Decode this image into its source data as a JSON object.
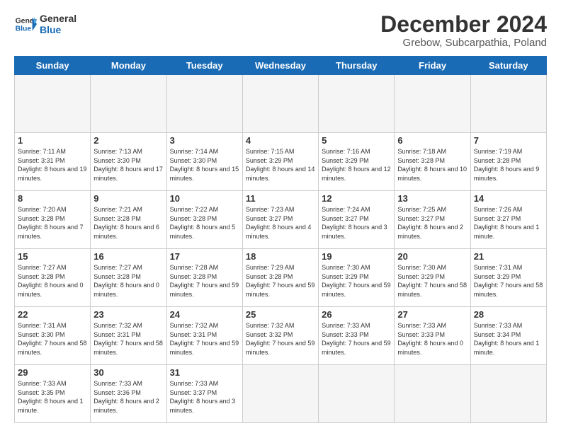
{
  "header": {
    "logo_general": "General",
    "logo_blue": "Blue",
    "month_title": "December 2024",
    "subtitle": "Grebow, Subcarpathia, Poland"
  },
  "days_of_week": [
    "Sunday",
    "Monday",
    "Tuesday",
    "Wednesday",
    "Thursday",
    "Friday",
    "Saturday"
  ],
  "cells": [
    {
      "day": "",
      "empty": true
    },
    {
      "day": "",
      "empty": true
    },
    {
      "day": "",
      "empty": true
    },
    {
      "day": "",
      "empty": true
    },
    {
      "day": "",
      "empty": true
    },
    {
      "day": "",
      "empty": true
    },
    {
      "day": "",
      "empty": true
    },
    {
      "day": "1",
      "sunrise": "Sunrise: 7:11 AM",
      "sunset": "Sunset: 3:31 PM",
      "daylight": "Daylight: 8 hours and 19 minutes."
    },
    {
      "day": "2",
      "sunrise": "Sunrise: 7:13 AM",
      "sunset": "Sunset: 3:30 PM",
      "daylight": "Daylight: 8 hours and 17 minutes."
    },
    {
      "day": "3",
      "sunrise": "Sunrise: 7:14 AM",
      "sunset": "Sunset: 3:30 PM",
      "daylight": "Daylight: 8 hours and 15 minutes."
    },
    {
      "day": "4",
      "sunrise": "Sunrise: 7:15 AM",
      "sunset": "Sunset: 3:29 PM",
      "daylight": "Daylight: 8 hours and 14 minutes."
    },
    {
      "day": "5",
      "sunrise": "Sunrise: 7:16 AM",
      "sunset": "Sunset: 3:29 PM",
      "daylight": "Daylight: 8 hours and 12 minutes."
    },
    {
      "day": "6",
      "sunrise": "Sunrise: 7:18 AM",
      "sunset": "Sunset: 3:28 PM",
      "daylight": "Daylight: 8 hours and 10 minutes."
    },
    {
      "day": "7",
      "sunrise": "Sunrise: 7:19 AM",
      "sunset": "Sunset: 3:28 PM",
      "daylight": "Daylight: 8 hours and 9 minutes."
    },
    {
      "day": "8",
      "sunrise": "Sunrise: 7:20 AM",
      "sunset": "Sunset: 3:28 PM",
      "daylight": "Daylight: 8 hours and 7 minutes."
    },
    {
      "day": "9",
      "sunrise": "Sunrise: 7:21 AM",
      "sunset": "Sunset: 3:28 PM",
      "daylight": "Daylight: 8 hours and 6 minutes."
    },
    {
      "day": "10",
      "sunrise": "Sunrise: 7:22 AM",
      "sunset": "Sunset: 3:28 PM",
      "daylight": "Daylight: 8 hours and 5 minutes."
    },
    {
      "day": "11",
      "sunrise": "Sunrise: 7:23 AM",
      "sunset": "Sunset: 3:27 PM",
      "daylight": "Daylight: 8 hours and 4 minutes."
    },
    {
      "day": "12",
      "sunrise": "Sunrise: 7:24 AM",
      "sunset": "Sunset: 3:27 PM",
      "daylight": "Daylight: 8 hours and 3 minutes."
    },
    {
      "day": "13",
      "sunrise": "Sunrise: 7:25 AM",
      "sunset": "Sunset: 3:27 PM",
      "daylight": "Daylight: 8 hours and 2 minutes."
    },
    {
      "day": "14",
      "sunrise": "Sunrise: 7:26 AM",
      "sunset": "Sunset: 3:27 PM",
      "daylight": "Daylight: 8 hours and 1 minute."
    },
    {
      "day": "15",
      "sunrise": "Sunrise: 7:27 AM",
      "sunset": "Sunset: 3:28 PM",
      "daylight": "Daylight: 8 hours and 0 minutes."
    },
    {
      "day": "16",
      "sunrise": "Sunrise: 7:27 AM",
      "sunset": "Sunset: 3:28 PM",
      "daylight": "Daylight: 8 hours and 0 minutes."
    },
    {
      "day": "17",
      "sunrise": "Sunrise: 7:28 AM",
      "sunset": "Sunset: 3:28 PM",
      "daylight": "Daylight: 7 hours and 59 minutes."
    },
    {
      "day": "18",
      "sunrise": "Sunrise: 7:29 AM",
      "sunset": "Sunset: 3:28 PM",
      "daylight": "Daylight: 7 hours and 59 minutes."
    },
    {
      "day": "19",
      "sunrise": "Sunrise: 7:30 AM",
      "sunset": "Sunset: 3:29 PM",
      "daylight": "Daylight: 7 hours and 59 minutes."
    },
    {
      "day": "20",
      "sunrise": "Sunrise: 7:30 AM",
      "sunset": "Sunset: 3:29 PM",
      "daylight": "Daylight: 7 hours and 58 minutes."
    },
    {
      "day": "21",
      "sunrise": "Sunrise: 7:31 AM",
      "sunset": "Sunset: 3:29 PM",
      "daylight": "Daylight: 7 hours and 58 minutes."
    },
    {
      "day": "22",
      "sunrise": "Sunrise: 7:31 AM",
      "sunset": "Sunset: 3:30 PM",
      "daylight": "Daylight: 7 hours and 58 minutes."
    },
    {
      "day": "23",
      "sunrise": "Sunrise: 7:32 AM",
      "sunset": "Sunset: 3:31 PM",
      "daylight": "Daylight: 7 hours and 58 minutes."
    },
    {
      "day": "24",
      "sunrise": "Sunrise: 7:32 AM",
      "sunset": "Sunset: 3:31 PM",
      "daylight": "Daylight: 7 hours and 59 minutes."
    },
    {
      "day": "25",
      "sunrise": "Sunrise: 7:32 AM",
      "sunset": "Sunset: 3:32 PM",
      "daylight": "Daylight: 7 hours and 59 minutes."
    },
    {
      "day": "26",
      "sunrise": "Sunrise: 7:33 AM",
      "sunset": "Sunset: 3:33 PM",
      "daylight": "Daylight: 7 hours and 59 minutes."
    },
    {
      "day": "27",
      "sunrise": "Sunrise: 7:33 AM",
      "sunset": "Sunset: 3:33 PM",
      "daylight": "Daylight: 8 hours and 0 minutes."
    },
    {
      "day": "28",
      "sunrise": "Sunrise: 7:33 AM",
      "sunset": "Sunset: 3:34 PM",
      "daylight": "Daylight: 8 hours and 1 minute."
    },
    {
      "day": "29",
      "sunrise": "Sunrise: 7:33 AM",
      "sunset": "Sunset: 3:35 PM",
      "daylight": "Daylight: 8 hours and 1 minute."
    },
    {
      "day": "30",
      "sunrise": "Sunrise: 7:33 AM",
      "sunset": "Sunset: 3:36 PM",
      "daylight": "Daylight: 8 hours and 2 minutes."
    },
    {
      "day": "31",
      "sunrise": "Sunrise: 7:33 AM",
      "sunset": "Sunset: 3:37 PM",
      "daylight": "Daylight: 8 hours and 3 minutes."
    },
    {
      "day": "",
      "empty": true
    },
    {
      "day": "",
      "empty": true
    },
    {
      "day": "",
      "empty": true
    },
    {
      "day": "",
      "empty": true
    }
  ]
}
